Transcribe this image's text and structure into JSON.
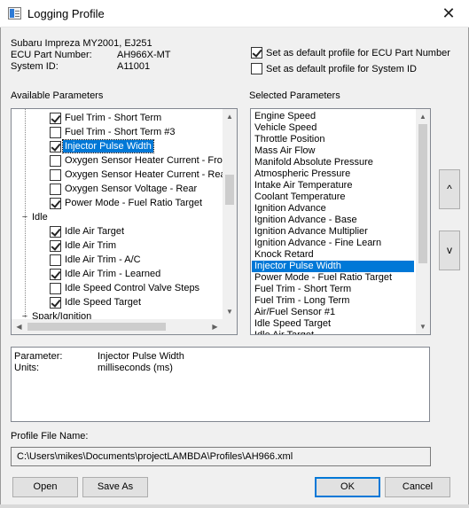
{
  "window": {
    "title": "Logging Profile",
    "close_glyph": "✕",
    "icon": "log-profile-icon"
  },
  "vehicle": {
    "name": "Subaru Impreza MY2001, EJ251",
    "ecu_label": "ECU Part Number:",
    "ecu_value": "AH966X-MT",
    "system_label": "System ID:",
    "system_value": "A11001"
  },
  "defaults": {
    "ecu_default": {
      "label": "Set as default profile for ECU Part Number",
      "checked": true
    },
    "system_default": {
      "label": "Set as default profile for System ID",
      "checked": false
    }
  },
  "available": {
    "heading": "Available Parameters",
    "rows": [
      {
        "type": "item",
        "label": "Fuel Trim - Short Term",
        "checked": true,
        "selected": false
      },
      {
        "type": "item",
        "label": "Fuel Trim - Short Term #3",
        "checked": false,
        "selected": false
      },
      {
        "type": "item",
        "label": "Injector Pulse Width",
        "checked": true,
        "selected": true
      },
      {
        "type": "item",
        "label": "Oxygen Sensor Heater Current - Front",
        "checked": false,
        "selected": false
      },
      {
        "type": "item",
        "label": "Oxygen Sensor Heater Current - Rear",
        "checked": false,
        "selected": false
      },
      {
        "type": "item",
        "label": "Oxygen Sensor Voltage - Rear",
        "checked": false,
        "selected": false
      },
      {
        "type": "item",
        "label": "Power Mode - Fuel Ratio Target",
        "checked": true,
        "selected": false
      },
      {
        "type": "category",
        "label": "Idle",
        "toggle": "−"
      },
      {
        "type": "item",
        "label": "Idle Air Target",
        "checked": true,
        "selected": false
      },
      {
        "type": "item",
        "label": "Idle Air Trim",
        "checked": true,
        "selected": false
      },
      {
        "type": "item",
        "label": "Idle Air Trim - A/C",
        "checked": false,
        "selected": false
      },
      {
        "type": "item",
        "label": "Idle Air Trim - Learned",
        "checked": true,
        "selected": false
      },
      {
        "type": "item",
        "label": "Idle Speed Control Valve Steps",
        "checked": false,
        "selected": false
      },
      {
        "type": "item",
        "label": "Idle Speed Target",
        "checked": true,
        "selected": false
      },
      {
        "type": "category",
        "label": "Spark/Ignition",
        "toggle": "−"
      }
    ],
    "scroll_up": "▲",
    "scroll_down": "▼",
    "scroll_left": "◀",
    "scroll_right": "▶"
  },
  "selected": {
    "heading": "Selected Parameters",
    "items": [
      "Engine Speed",
      "Vehicle Speed",
      "Throttle Position",
      "Mass Air Flow",
      "Manifold Absolute Pressure",
      "Atmospheric Pressure",
      "Intake Air Temperature",
      "Coolant Temperature",
      "Ignition Advance",
      "Ignition Advance - Base",
      "Ignition Advance Multiplier",
      "Ignition Advance - Fine Learn",
      "Knock Retard",
      "Injector Pulse Width",
      "Power Mode - Fuel Ratio Target",
      "Fuel Trim - Short Term",
      "Fuel Trim - Long Term",
      "Air/Fuel Sensor #1",
      "Idle Speed Target",
      "Idle Air Target"
    ],
    "selected_item": "Injector Pulse Width",
    "scroll_up": "▲",
    "scroll_down": "▼",
    "move_up": "^",
    "move_down": "v"
  },
  "details": {
    "parameter_label": "Parameter:",
    "parameter_value": "Injector Pulse Width",
    "units_label": "Units:",
    "units_value": "milliseconds (ms)"
  },
  "profile_file": {
    "label": "Profile File Name:",
    "path": "C:\\Users\\mikes\\Documents\\projectLAMBDA\\Profiles\\AH966.xml"
  },
  "buttons": {
    "open": "Open",
    "save_as": "Save As",
    "ok": "OK",
    "cancel": "Cancel"
  }
}
